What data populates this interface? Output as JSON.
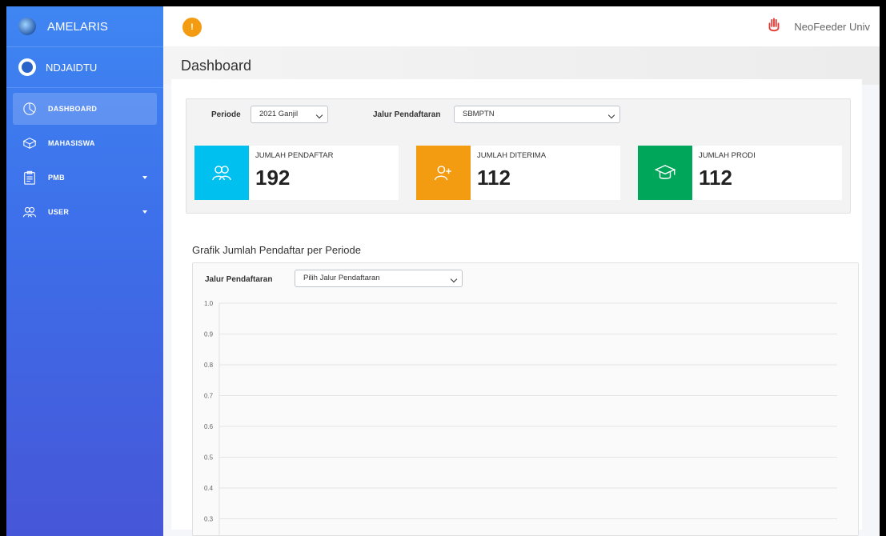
{
  "sidebar": {
    "brand": "AMELARIS",
    "user": "NDJAIDTU",
    "items": [
      {
        "label": "DASHBOARD",
        "icon": "pie-chart-icon",
        "active": true,
        "has_submenu": false
      },
      {
        "label": "MAHASISWA",
        "icon": "box-icon",
        "active": false,
        "has_submenu": false
      },
      {
        "label": "PMB",
        "icon": "clipboard-icon",
        "active": false,
        "has_submenu": true
      },
      {
        "label": "USER",
        "icon": "users-icon",
        "active": false,
        "has_submenu": true
      }
    ]
  },
  "topbar": {
    "alert_label": "!",
    "user_name": "NeoFeeder Univ"
  },
  "page": {
    "title": "Dashboard"
  },
  "filters": {
    "periode_label": "Periode",
    "periode_value": "2021 Ganjil",
    "jalur_label": "Jalur Pendaftaran",
    "jalur_value": "SBMPTN"
  },
  "stats": [
    {
      "label": "JUMLAH PENDAFTAR",
      "value": "192",
      "color": "#00c0ef",
      "icon": "users-icon"
    },
    {
      "label": "JUMLAH DITERIMA",
      "value": "112",
      "color": "#f39c12",
      "icon": "user-plus-icon"
    },
    {
      "label": "JUMLAH PRODI",
      "value": "112",
      "color": "#00a65a",
      "icon": "graduation-cap-icon"
    }
  ],
  "chart_section": {
    "title": "Grafik Jumlah Pendaftar per Periode",
    "jalur_label": "Jalur Pendaftaran",
    "jalur_placeholder": "Pilih Jalur Pendaftaran"
  },
  "chart_data": {
    "type": "line",
    "title": "",
    "xlabel": "",
    "ylabel": "",
    "series": [],
    "ylim": [
      0,
      1.0
    ],
    "yticks": [
      "1.0",
      "0.9",
      "0.8",
      "0.7",
      "0.6",
      "0.5",
      "0.4",
      "0.3"
    ],
    "grid": true
  }
}
